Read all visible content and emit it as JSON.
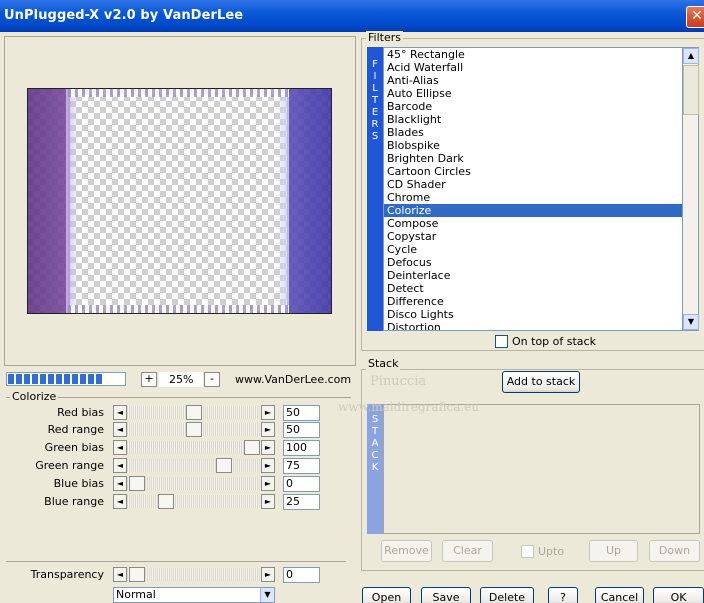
{
  "window": {
    "title": "UnPlugged-X v2.0 by VanDerLee",
    "close_glyph": "✕"
  },
  "preview": {
    "zoom_minus": "-",
    "zoom_plus": "+",
    "zoom_value": "25%",
    "website": "www.VanDerLee.com",
    "progress_segments": 12
  },
  "colorize": {
    "group_title": "Colorize",
    "sliders": [
      {
        "label": "Red bias",
        "value": "50"
      },
      {
        "label": "Red range",
        "value": "50"
      },
      {
        "label": "Green bias",
        "value": "100"
      },
      {
        "label": "Green range",
        "value": "75"
      },
      {
        "label": "Blue bias",
        "value": "0"
      },
      {
        "label": "Blue range",
        "value": "25"
      }
    ],
    "transparency": {
      "label": "Transparency",
      "value": "0"
    },
    "blend_mode": "Normal"
  },
  "filters": {
    "group_title": "Filters",
    "banner": "FILTERS",
    "items": [
      "45° Rectangle",
      "Acid Waterfall",
      "Anti-Alias",
      "Auto Ellipse",
      "Barcode",
      "Blacklight",
      "Blades",
      "Blobspike",
      "Brighten Dark",
      "Cartoon Circles",
      "CD Shader",
      "Chrome",
      "Colorize",
      "Compose",
      "Copystar",
      "Cycle",
      "Defocus",
      "Deinterlace",
      "Detect",
      "Difference",
      "Disco Lights",
      "Distortion"
    ],
    "selected": "Colorize",
    "on_top_label": "On top of stack"
  },
  "stack": {
    "group_title": "Stack",
    "add_label": "Add to stack",
    "banner": "STACK",
    "remove_label": "Remove",
    "clear_label": "Clear",
    "upto_label": "Upto",
    "up_label": "Up",
    "down_label": "Down"
  },
  "footer": {
    "open_label": "Open",
    "save_label": "Save",
    "delete_label": "Delete",
    "help_label": "?",
    "cancel_label": "Cancel",
    "ok_label": "OK"
  },
  "watermark": {
    "line1": "Pinuccia",
    "line2": "www.maidiregrafica.eu"
  },
  "icons": {
    "left_arrow": "◄",
    "right_arrow": "►",
    "up_arrow": "▲",
    "down_arrow": "▼"
  },
  "colors": {
    "title_bar": "#0a5ad8",
    "selection": "#316ac5",
    "filters_banner": "#1f57d6",
    "stack_banner": "#8aa4e2"
  }
}
